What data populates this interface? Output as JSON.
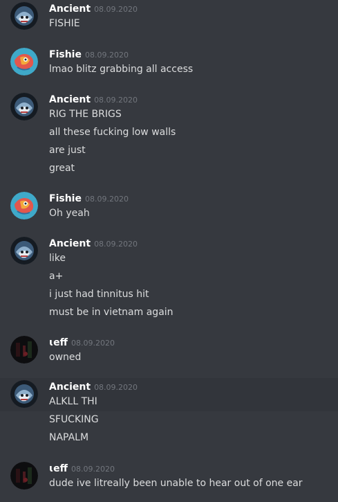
{
  "messages": [
    {
      "author": "Ancient",
      "timestamp": "08.09.2020",
      "avatar": "ancient-avatar",
      "lines": [
        "FISHIE"
      ]
    },
    {
      "author": "Fishie",
      "timestamp": "08.09.2020",
      "avatar": "fishie-avatar",
      "lines": [
        "lmao blitz grabbing all access"
      ]
    },
    {
      "author": "Ancient",
      "timestamp": "08.09.2020",
      "avatar": "ancient-avatar",
      "lines": [
        "RIG THE BRIGS",
        "all these fucking low walls",
        "are just",
        "great"
      ]
    },
    {
      "author": "Fishie",
      "timestamp": "08.09.2020",
      "avatar": "fishie-avatar",
      "lines": [
        "Oh yeah"
      ]
    },
    {
      "author": "Ancient",
      "timestamp": "08.09.2020",
      "avatar": "ancient-avatar",
      "lines": [
        "like",
        "a+",
        "i just had tinnitus hit",
        "must be in vietnam again"
      ]
    },
    {
      "author": "ɩeff",
      "timestamp": "08.09.2020",
      "avatar": "leff-avatar",
      "lines": [
        "owned"
      ]
    },
    {
      "author": "Ancient",
      "timestamp": "08.09.2020",
      "avatar": "ancient-avatar",
      "lines": [
        "ALKLL THI",
        "SFUCKING",
        "NAPALM"
      ]
    },
    {
      "author": "ɩeff",
      "timestamp": "08.09.2020",
      "avatar": "leff-avatar",
      "lines": [
        "dude ive litreally been unable to hear out of one ear"
      ]
    }
  ],
  "colors": {
    "background": "#36393f",
    "highlight": "#32353b",
    "username": "#ffffff",
    "timestamp": "#72767d",
    "text": "#dcddde"
  }
}
